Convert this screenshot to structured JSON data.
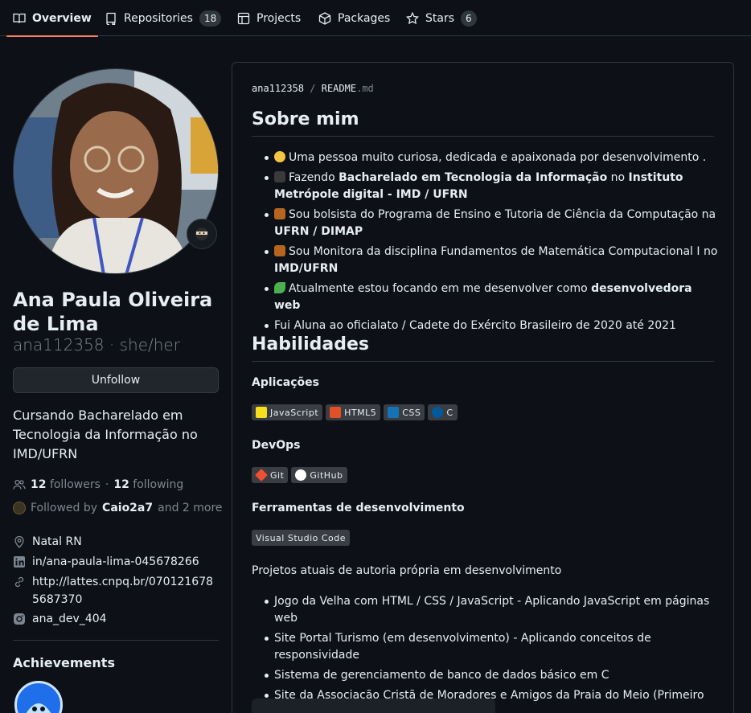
{
  "nav": {
    "tabs": [
      {
        "label": "Overview",
        "icon": "book-icon"
      },
      {
        "label": "Repositories",
        "icon": "repo-icon",
        "count": "18"
      },
      {
        "label": "Projects",
        "icon": "table-icon"
      },
      {
        "label": "Packages",
        "icon": "package-icon"
      },
      {
        "label": "Stars",
        "icon": "star-icon",
        "count": "6"
      }
    ]
  },
  "profile": {
    "fullname": "Ana Paula Oliveira de Lima",
    "username_line": "ana112358 · she/her",
    "follow_button": "Unfollow",
    "bio": "Cursando Bacharelado em Tecnologia da Informação no IMD/UFRN",
    "followers_count": "12",
    "followers_label": "followers",
    "following_sep": "·",
    "following_count": "12",
    "following_label": "following",
    "followed_by_prefix": "Followed by",
    "followed_by_user": "Caio2a7",
    "followed_by_suffix": "and 2 more",
    "location": "Natal RN",
    "linkedin": "in/ana-paula-lima-045678266",
    "website": "http://lattes.cnpq.br/0701216785687370",
    "instagram": "ana_dev_404",
    "achievements_title": "Achievements"
  },
  "readme": {
    "crumb_user": "ana112358",
    "crumb_sep": "/",
    "crumb_file": "README",
    "crumb_ext": ".md",
    "section1_title": "Sobre mim",
    "about": [
      {
        "emoji": "thinking-emoji",
        "pre": "Uma pessoa muito curiosa, dedicada e apaixonada por desenvolvimento ."
      },
      {
        "emoji": "grad-cap-emoji",
        "pre": "Fazendo ",
        "b1": "Bacharelado em Tecnologia da Informação",
        "mid": " no ",
        "b2": "Instituto Metrópole digital - IMD / UFRN"
      },
      {
        "emoji": "briefcase-emoji",
        "pre": "Sou bolsista do Programa de Ensino e Tutoria de Ciência da Computação na ",
        "b1": "UFRN / DIMAP"
      },
      {
        "emoji": "briefcase-emoji",
        "pre": "Sou Monitora da disciplina Fundamentos de Matemática Computacional I no ",
        "b1": "IMD/UFRN"
      },
      {
        "emoji": "seedling-emoji",
        "pre": "Atualmente estou focando em me desenvolver como ",
        "b1": "desenvolvedora web"
      },
      {
        "pre": "Fui Aluna ao oficialato / Cadete do Exército Brasileiro de 2020 até 2021"
      }
    ],
    "section2_title": "Habilidades",
    "apps_title": "Aplicações",
    "apps": [
      {
        "label": "JavaScript",
        "color": "#f7df1e"
      },
      {
        "label": "HTML5",
        "color": "#e34f26"
      },
      {
        "label": "CSS",
        "color": "#1572b6"
      },
      {
        "label": "C",
        "color": "#00599c"
      }
    ],
    "devops_title": "DevOps",
    "devops": [
      {
        "label": "Git",
        "color": "#f05032"
      },
      {
        "label": "GitHub",
        "color": "#ffffff"
      }
    ],
    "tools_title": "Ferramentas de desenvolvimento",
    "tools": [
      {
        "label": "Visual Studio Code"
      }
    ],
    "projects_intro": "Projetos atuais de autoria própria em desenvolvimento",
    "projects": [
      "Jogo da Velha com HTML / CSS / JavaScript - Aplicando JavaScript em páginas web",
      "Site Portal Turismo (em desenvolvimento) - Aplicando conceitos de responsividade",
      "Sistema de gerenciamento de banco de dados básico em C",
      "Site da Associação Cristã de Moradores e Amigos da Praia do Meio (Primeiro projeto de desenvolvimento web)"
    ]
  },
  "colors": {
    "background": "#0d1117",
    "border": "#30363d",
    "muted": "#7d8590",
    "accent_underline": "#f78166"
  }
}
